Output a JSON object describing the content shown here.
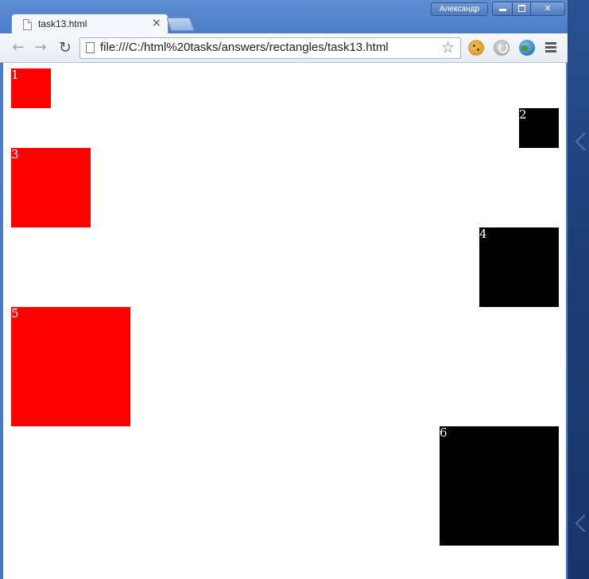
{
  "window": {
    "user_label": "Александр",
    "tab": {
      "title": "task13.html"
    }
  },
  "toolbar": {
    "url": "file:///C:/html%20tasks/answers/rectangles/task13.html"
  },
  "icons": {
    "back": "back-arrow-icon",
    "forward": "forward-arrow-icon",
    "reload": "reload-icon",
    "star": "star-icon",
    "cookie": "cookie-extension-icon",
    "power": "power-extension-icon",
    "globe": "globe-extension-icon",
    "menu": "menu-icon"
  },
  "page": {
    "squares": [
      {
        "label": "1",
        "color": "#ff0000"
      },
      {
        "label": "2",
        "color": "#000000"
      },
      {
        "label": "3",
        "color": "#ff0000"
      },
      {
        "label": "4",
        "color": "#000000"
      },
      {
        "label": "5",
        "color": "#ff0000"
      },
      {
        "label": "6",
        "color": "#000000"
      }
    ]
  }
}
